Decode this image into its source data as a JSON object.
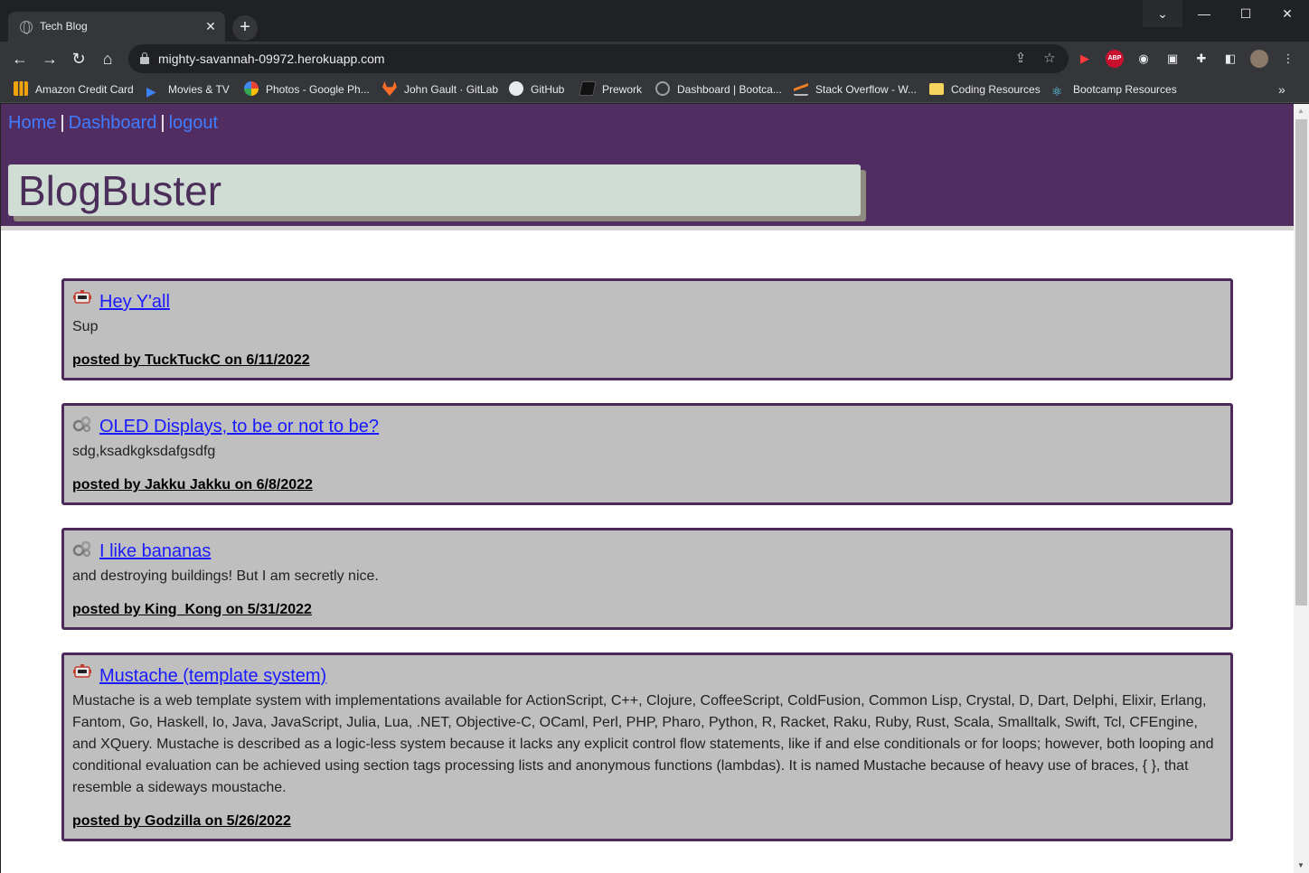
{
  "browser": {
    "tab_title": "Tech Blog",
    "tab_close": "✕",
    "new_tab": "+",
    "url": "mighty-savannah-09972.herokuapp.com",
    "bookmarks": [
      {
        "label": "Amazon Credit Card",
        "icon": "amazon-icon",
        "color": "#f0a30a"
      },
      {
        "label": "Movies & TV",
        "icon": "play-icon",
        "color": "#3b82f6"
      },
      {
        "label": "Photos - Google Ph...",
        "icon": "pinwheel-icon",
        "color": "#ea4335"
      },
      {
        "label": "John Gault · GitLab",
        "icon": "gitlab-icon",
        "color": "#fc6d26"
      },
      {
        "label": "GitHub",
        "icon": "github-icon",
        "color": "#e8eaed"
      },
      {
        "label": "Prework",
        "icon": "book-icon",
        "color": "#1f1f1f"
      },
      {
        "label": "Dashboard | Bootca...",
        "icon": "globe-icon",
        "color": "#9aa0a6"
      },
      {
        "label": "Stack Overflow - W...",
        "icon": "stackoverflow-icon",
        "color": "#f48024"
      },
      {
        "label": "Coding Resources",
        "icon": "folder-icon",
        "color": "#f4d35e"
      },
      {
        "label": "Bootcamp Resources",
        "icon": "react-icon",
        "color": "#61dafb"
      }
    ],
    "bookmarks_more": "»"
  },
  "site": {
    "nav": {
      "home": "Home",
      "dashboard": "Dashboard",
      "logout": "logout",
      "separator": "|"
    },
    "brand": "BlogBuster",
    "colors": {
      "header": "#522d62",
      "link": "#3f7cff",
      "card": "#bfbfbf",
      "card_border": "#4b2a5a",
      "title_link": "#1a1aff"
    }
  },
  "posts": [
    {
      "title": "Hey Y'all",
      "body": "Sup",
      "meta": "posted by TuckTuckC on 6/11/2022",
      "avatar": "robot-icon"
    },
    {
      "title": "OLED Displays, to be or not to be?",
      "body": "sdg,ksadkgksdafgsdfg",
      "meta": "posted by Jakku Jakku on 6/8/2022",
      "avatar": "gears-icon"
    },
    {
      "title": "I like bananas",
      "body": "and destroying buildings! But I am secretly nice.",
      "meta": "posted by King_Kong on 5/31/2022",
      "avatar": "gears-icon"
    },
    {
      "title": "Mustache (template system)",
      "body": "Mustache is a web template system with implementations available for ActionScript, C++, Clojure, CoffeeScript, ColdFusion, Common Lisp, Crystal, D, Dart, Delphi, Elixir, Erlang, Fantom, Go, Haskell, Io, Java, JavaScript, Julia, Lua, .NET, Objective-C, OCaml, Perl, PHP, Pharo, Python, R, Racket, Raku, Ruby, Rust, Scala, Smalltalk, Swift, Tcl, CFEngine, and XQuery. Mustache is described as a logic-less system because it lacks any explicit control flow statements, like if and else conditionals or for loops; however, both looping and conditional evaluation can be achieved using section tags processing lists and anonymous functions (lambdas). It is named Mustache because of heavy use of braces, { }, that resemble a sideways moustache.",
      "meta": "posted by Godzilla on 5/26/2022",
      "avatar": "robot-icon"
    }
  ]
}
